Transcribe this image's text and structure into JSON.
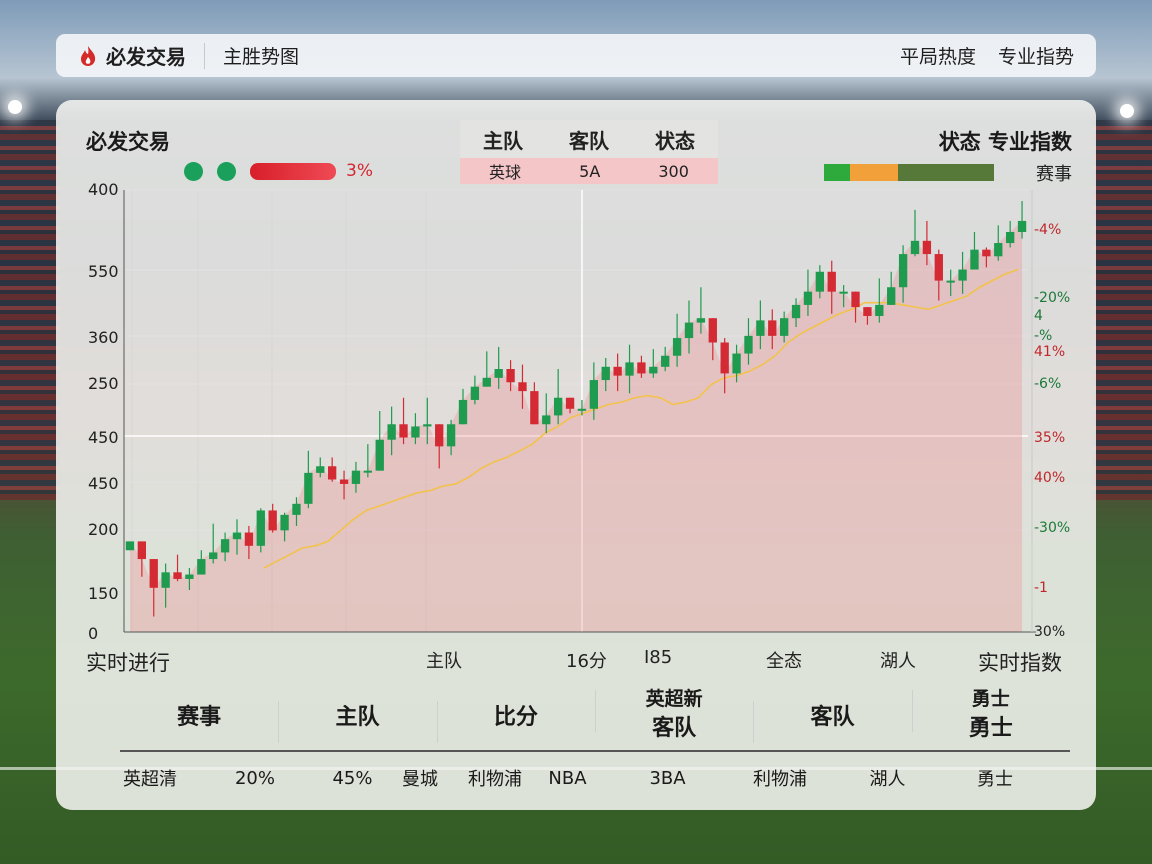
{
  "topbar": {
    "brand": "必发交易",
    "title": "主胜势图",
    "links": [
      "平局热度",
      "专业指势"
    ]
  },
  "card": {
    "title": "必发交易",
    "indicator_pct": "3%",
    "right_title": "状态 专业指数",
    "legend_label": "赛事",
    "legend_colors": [
      "#2eaa3c",
      "#f2a03a",
      "#56793a",
      "#f6f6f2"
    ],
    "mini_table": {
      "headers": [
        "主队",
        "客队",
        "状态"
      ],
      "row": [
        "英球",
        "5A",
        "300"
      ]
    }
  },
  "chart_data": {
    "type": "candlestick",
    "y_tick_labels": [
      "400",
      "550",
      "360",
      "250",
      "450",
      "450",
      "200",
      "150",
      "0"
    ],
    "right_tick_labels": [
      {
        "text": "-4%",
        "color": "#c0272d"
      },
      {
        "text": "-20%",
        "color": "#1d7a3a"
      },
      {
        "text": "4",
        "color": "#1d7a3a"
      },
      {
        "text": "-%",
        "color": "#1d7a3a"
      },
      {
        "text": "41%",
        "color": "#c0272d"
      },
      {
        "text": "-6%",
        "color": "#1d7a3a"
      },
      {
        "text": "35%",
        "color": "#c0272d"
      },
      {
        "text": "40%",
        "color": "#c0272d"
      },
      {
        "text": "-30%",
        "color": "#1d7a3a"
      },
      {
        "text": "-1",
        "color": "#c0272d"
      },
      {
        "text": "30%",
        "color": "#222222"
      }
    ],
    "x_tick_labels": [
      "实时进行",
      "主队",
      "16分",
      "I85",
      "全态",
      "湖人",
      "实时指数"
    ],
    "up_color": "#1e9b4f",
    "down_color": "#d42a33",
    "candles": [
      [
        452,
        456,
        446,
        459,
        441
      ],
      [
        456,
        448,
        452,
        440,
        445
      ],
      [
        448,
        435,
        427,
        422,
        439
      ],
      [
        435,
        442,
        439,
        426,
        446
      ],
      [
        442,
        439,
        447,
        438,
        450
      ],
      [
        439,
        441,
        439,
        434,
        444
      ],
      [
        441,
        448,
        445,
        444,
        452
      ],
      [
        448,
        451,
        459,
        446,
        464
      ],
      [
        451,
        457,
        457,
        447,
        460
      ],
      [
        457,
        460,
        461,
        450,
        466
      ],
      [
        460,
        454,
        451,
        448,
        463
      ],
      [
        454,
        470,
        470,
        451,
        471
      ],
      [
        470,
        461,
        470,
        460,
        473
      ],
      [
        461,
        468,
        467,
        456,
        469
      ],
      [
        468,
        473,
        470,
        463,
        476
      ],
      [
        473,
        487,
        489,
        471,
        497
      ],
      [
        487,
        490,
        491,
        485,
        494
      ],
      [
        490,
        484,
        491,
        483,
        494
      ],
      [
        484,
        482,
        485,
        475,
        488
      ],
      [
        482,
        488,
        486,
        478,
        492
      ],
      [
        488,
        488,
        493,
        485,
        500
      ],
      [
        488,
        502,
        511,
        492,
        515
      ],
      [
        502,
        509,
        507,
        495,
        517
      ],
      [
        509,
        503,
        499,
        500,
        521
      ],
      [
        503,
        508,
        505,
        500,
        514
      ],
      [
        508,
        509,
        516,
        500,
        521
      ],
      [
        509,
        499,
        502,
        489,
        509
      ],
      [
        499,
        509,
        497,
        495,
        511
      ],
      [
        509,
        520,
        518,
        511,
        525
      ],
      [
        520,
        526,
        522,
        518,
        531
      ],
      [
        526,
        530,
        535,
        527,
        542
      ],
      [
        530,
        534,
        528,
        525,
        544
      ],
      [
        534,
        528,
        530,
        524,
        538
      ],
      [
        528,
        524,
        519,
        516,
        536
      ],
      [
        524,
        509,
        519,
        510,
        528
      ],
      [
        509,
        513,
        513,
        505,
        523
      ],
      [
        513,
        521,
        522,
        509,
        534
      ],
      [
        521,
        516,
        513,
        514,
        521
      ],
      [
        516,
        516,
        513,
        513,
        520
      ],
      [
        516,
        529,
        527,
        511,
        537
      ],
      [
        529,
        535,
        533,
        524,
        539
      ],
      [
        535,
        531,
        533,
        524,
        541
      ],
      [
        531,
        537,
        539,
        523,
        545
      ],
      [
        537,
        532,
        529,
        530,
        540
      ],
      [
        532,
        535,
        538,
        530,
        543
      ],
      [
        535,
        540,
        537,
        533,
        544
      ],
      [
        540,
        548,
        553,
        535,
        559
      ],
      [
        548,
        555,
        557,
        541,
        565
      ],
      [
        555,
        557,
        551,
        550,
        571
      ],
      [
        557,
        546,
        544,
        538,
        557
      ],
      [
        546,
        532,
        535,
        523,
        548
      ],
      [
        532,
        541,
        538,
        528,
        545
      ],
      [
        541,
        549,
        548,
        536,
        557
      ],
      [
        549,
        556,
        560,
        543,
        565
      ],
      [
        556,
        549,
        547,
        543,
        561
      ],
      [
        549,
        557,
        552,
        546,
        560
      ],
      [
        557,
        563,
        560,
        553,
        566
      ],
      [
        563,
        569,
        576,
        558,
        579
      ],
      [
        569,
        578,
        575,
        566,
        581
      ],
      [
        578,
        569,
        573,
        559,
        583
      ],
      [
        569,
        569,
        562,
        562,
        572
      ],
      [
        569,
        562,
        566,
        555,
        569
      ],
      [
        562,
        558,
        556,
        554,
        562
      ],
      [
        558,
        563,
        570,
        555,
        575
      ],
      [
        563,
        571,
        574,
        568,
        578
      ],
      [
        571,
        586,
        588,
        564,
        590
      ],
      [
        586,
        592,
        600,
        585,
        606
      ],
      [
        592,
        586,
        593,
        581,
        601
      ],
      [
        586,
        574,
        578,
        565,
        588
      ],
      [
        574,
        574,
        569,
        567,
        579
      ],
      [
        574,
        579,
        582,
        568,
        587
      ],
      [
        579,
        588,
        586,
        585,
        596
      ],
      [
        588,
        585,
        586,
        580,
        589
      ],
      [
        585,
        591,
        590,
        583,
        599
      ],
      [
        591,
        596,
        591,
        589,
        601
      ],
      [
        596,
        601,
        603,
        593,
        610
      ]
    ],
    "smooth_line": [
      444,
      447,
      450,
      453,
      454,
      456,
      461,
      466,
      470,
      472,
      474,
      476,
      478,
      479,
      481,
      482,
      485,
      489,
      492,
      494,
      497,
      500,
      505,
      508,
      512,
      514,
      516,
      518,
      519,
      521,
      522,
      521,
      518,
      519,
      521,
      527,
      530,
      531,
      533,
      536,
      540,
      546,
      550,
      553,
      556,
      559,
      561,
      564,
      564,
      564,
      563,
      562,
      561,
      563,
      565,
      567,
      571,
      574,
      577,
      579
    ],
    "fill_color": "#f08a90",
    "line_color": "#f2c24b"
  },
  "bottom_table": {
    "headers": [
      "赛事",
      "主队",
      "比分",
      "客队",
      "客队",
      "勇士"
    ],
    "header_tops": {
      "col4": "英超新",
      "col6": "勇士"
    },
    "row": [
      "英超清",
      "20%",
      "45%",
      "曼城",
      "利物浦",
      "NBA",
      "3BA",
      "利物浦",
      "湖人",
      "勇士"
    ]
  }
}
